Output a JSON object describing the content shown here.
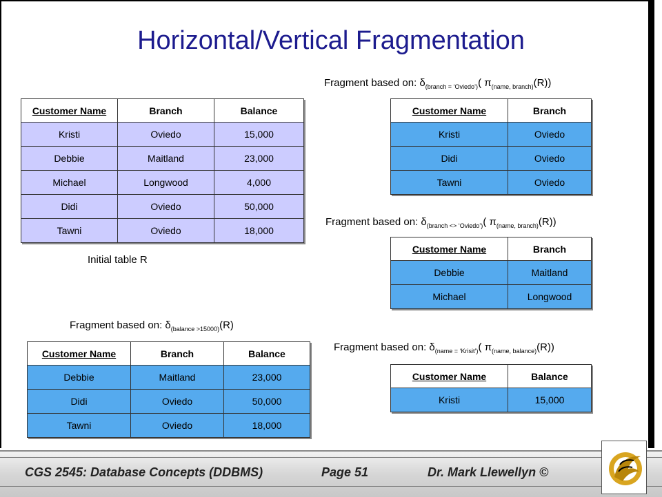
{
  "title": "Horizontal/Vertical Fragmentation",
  "captions": {
    "initial": "Initial table R",
    "f1_prefix": "Fragment based on: δ",
    "f1_sub1": "(branch = ‘Oviedo’)",
    "f1_mid": "( π",
    "f1_sub2": "(name, branch)",
    "f1_suffix": "(R))",
    "f2_prefix": "Fragment based on: δ",
    "f2_sub1": "(branch <> ‘Oviedo’)",
    "f2_mid": "( π",
    "f2_sub2": "(name, branch)",
    "f2_suffix": "(R))",
    "f3_prefix": "Fragment based on: δ",
    "f3_sub1": "(balance >15000)",
    "f3_suffix": "(R)",
    "f4_prefix": "Fragment based on: δ",
    "f4_sub1": "(name = ‘Krisit’)",
    "f4_mid": "( π",
    "f4_sub2": "(name, balance)",
    "f4_suffix": "(R))"
  },
  "table_r": {
    "headers": [
      "Customer Name",
      "Branch",
      "Balance"
    ],
    "rows": [
      [
        "Kristi",
        "Oviedo",
        "15,000"
      ],
      [
        "Debbie",
        "Maitland",
        "23,000"
      ],
      [
        "Michael",
        "Longwood",
        "4,000"
      ],
      [
        "Didi",
        "Oviedo",
        "50,000"
      ],
      [
        "Tawni",
        "Oviedo",
        "18,000"
      ]
    ]
  },
  "table_f1": {
    "headers": [
      "Customer Name",
      "Branch"
    ],
    "rows": [
      [
        "Kristi",
        "Oviedo"
      ],
      [
        "Didi",
        "Oviedo"
      ],
      [
        "Tawni",
        "Oviedo"
      ]
    ]
  },
  "table_f2": {
    "headers": [
      "Customer Name",
      "Branch"
    ],
    "rows": [
      [
        "Debbie",
        "Maitland"
      ],
      [
        "Michael",
        "Longwood"
      ]
    ]
  },
  "table_f3": {
    "headers": [
      "Customer Name",
      "Branch",
      "Balance"
    ],
    "rows": [
      [
        "Debbie",
        "Maitland",
        "23,000"
      ],
      [
        "Didi",
        "Oviedo",
        "50,000"
      ],
      [
        "Tawni",
        "Oviedo",
        "18,000"
      ]
    ]
  },
  "table_f4": {
    "headers": [
      "Customer Name",
      "Balance"
    ],
    "rows": [
      [
        "Kristi",
        "15,000"
      ]
    ]
  },
  "footer": {
    "course": "CGS 2545: Database Concepts  (DDBMS)",
    "page": "Page 51",
    "author": "Dr. Mark Llewellyn ©"
  },
  "colors": {
    "title": "#1c1b8e",
    "lavender": "#ccccff",
    "blue": "#55aaee"
  },
  "logo_icon": "pegasus-logo-icon"
}
